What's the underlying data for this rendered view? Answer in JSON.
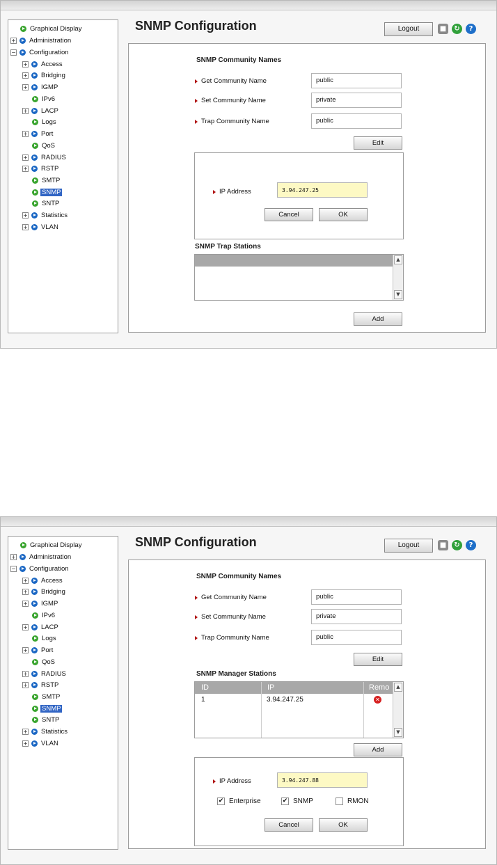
{
  "nav": {
    "items": [
      {
        "label": "Graphical Display"
      },
      {
        "label": "Administration"
      },
      {
        "label": "Configuration"
      },
      {
        "label": "Access"
      },
      {
        "label": "Bridging"
      },
      {
        "label": "IGMP"
      },
      {
        "label": "IPv6"
      },
      {
        "label": "LACP"
      },
      {
        "label": "Logs"
      },
      {
        "label": "Port"
      },
      {
        "label": "QoS"
      },
      {
        "label": "RADIUS"
      },
      {
        "label": "RSTP"
      },
      {
        "label": "SMTP"
      },
      {
        "label": "SNMP"
      },
      {
        "label": "SNTP"
      },
      {
        "label": "Statistics"
      },
      {
        "label": "VLAN"
      }
    ],
    "selected": "SNMP",
    "expand_symbol": "+",
    "collapse_symbol": "−"
  },
  "header": {
    "title": "SNMP Configuration",
    "logout_label": "Logout",
    "save_glyph": "■",
    "refresh_glyph": "↻",
    "help_glyph": "?"
  },
  "community": {
    "heading": "SNMP Community Names",
    "get_label": "Get Community Name",
    "get_value": "public",
    "set_label": "Set Community Name",
    "set_value": "private",
    "trap_label": "Trap Community Name",
    "trap_value": "public",
    "edit_label": "Edit"
  },
  "shot1": {
    "ip_label": "IP Address",
    "ip_value": "3.94.247.25",
    "cancel_label": "Cancel",
    "ok_label": "OK",
    "trap_heading": "SNMP Trap Stations",
    "add_label": "Add"
  },
  "shot2": {
    "manager_heading": "SNMP Manager Stations",
    "table": {
      "columns": [
        "ID",
        "IP",
        "Remo"
      ],
      "rows": [
        {
          "id": "1",
          "ip": "3.94.247.25"
        }
      ]
    },
    "add_label": "Add",
    "ip_label": "IP Address",
    "ip_value": "3.94.247.88",
    "checkboxes": [
      {
        "label": "Enterprise",
        "checked": true
      },
      {
        "label": "SNMP",
        "checked": true
      },
      {
        "label": "RMON",
        "checked": false
      }
    ],
    "check_glyph": "✔",
    "cancel_label": "Cancel",
    "ok_label": "OK"
  },
  "scroll": {
    "up": "▲",
    "down": "▼"
  },
  "remove_glyph": "✕",
  "colors": {
    "selected_bg": "#3165c4",
    "field_highlight": "#fdf9c4",
    "arrow": "#b01414",
    "table_header": "#a8a8a8"
  }
}
